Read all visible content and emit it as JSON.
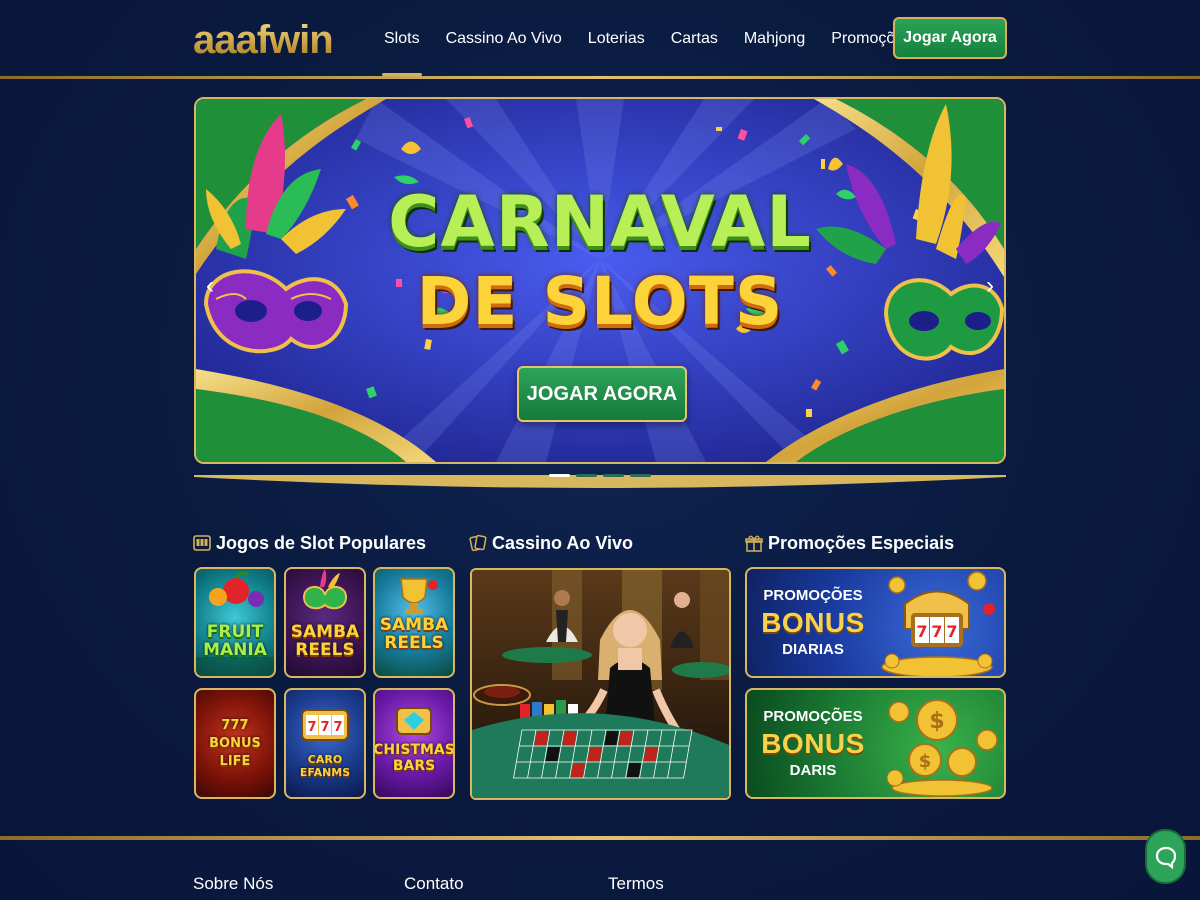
{
  "brand": {
    "logo_text": "aaafwin"
  },
  "nav": {
    "items": [
      {
        "label": "Slots"
      },
      {
        "label": "Cassino Ao Vivo"
      },
      {
        "label": "Loterias"
      },
      {
        "label": "Cartas"
      },
      {
        "label": "Mahjong"
      },
      {
        "label": "Promoções"
      }
    ],
    "active_index": 0,
    "cta_label": "Jogar Agora"
  },
  "hero": {
    "title_line1": "CARNAVAL",
    "title_line2": "DE SLOTS",
    "cta_label": "JOGAR AGORA",
    "slide_count": 4,
    "active_slide": 1
  },
  "sections": {
    "slots": {
      "title": "Jogos de Slot Populares",
      "icon": "slot-machine-icon",
      "games": [
        {
          "name": "FRUIT MANIA"
        },
        {
          "name": "SAMBA REELS"
        },
        {
          "name": "SAMBA REELS"
        },
        {
          "name": "777 BONUS LIFE"
        },
        {
          "name": "CARO EFANMS"
        },
        {
          "name": "CHISTMAS BARS"
        }
      ]
    },
    "live": {
      "title": "Cassino Ao Vivo",
      "icon": "playing-cards-icon"
    },
    "promos": {
      "title": "Promoções Especiais",
      "icon": "gift-icon",
      "items": [
        {
          "line1": "PROMOÇÕES",
          "line2": "BONUS",
          "line3": "DIARIAS"
        },
        {
          "line1": "PROMOÇÕES",
          "line2": "BONUS",
          "line3": "DARIS"
        }
      ]
    }
  },
  "footer": {
    "links": [
      {
        "label": "Sobre Nós"
      },
      {
        "label": "Contato"
      },
      {
        "label": "Termos"
      }
    ]
  },
  "colors": {
    "gold": "#d4b15a",
    "green": "#1f9148",
    "navy": "#0a1a3e"
  }
}
